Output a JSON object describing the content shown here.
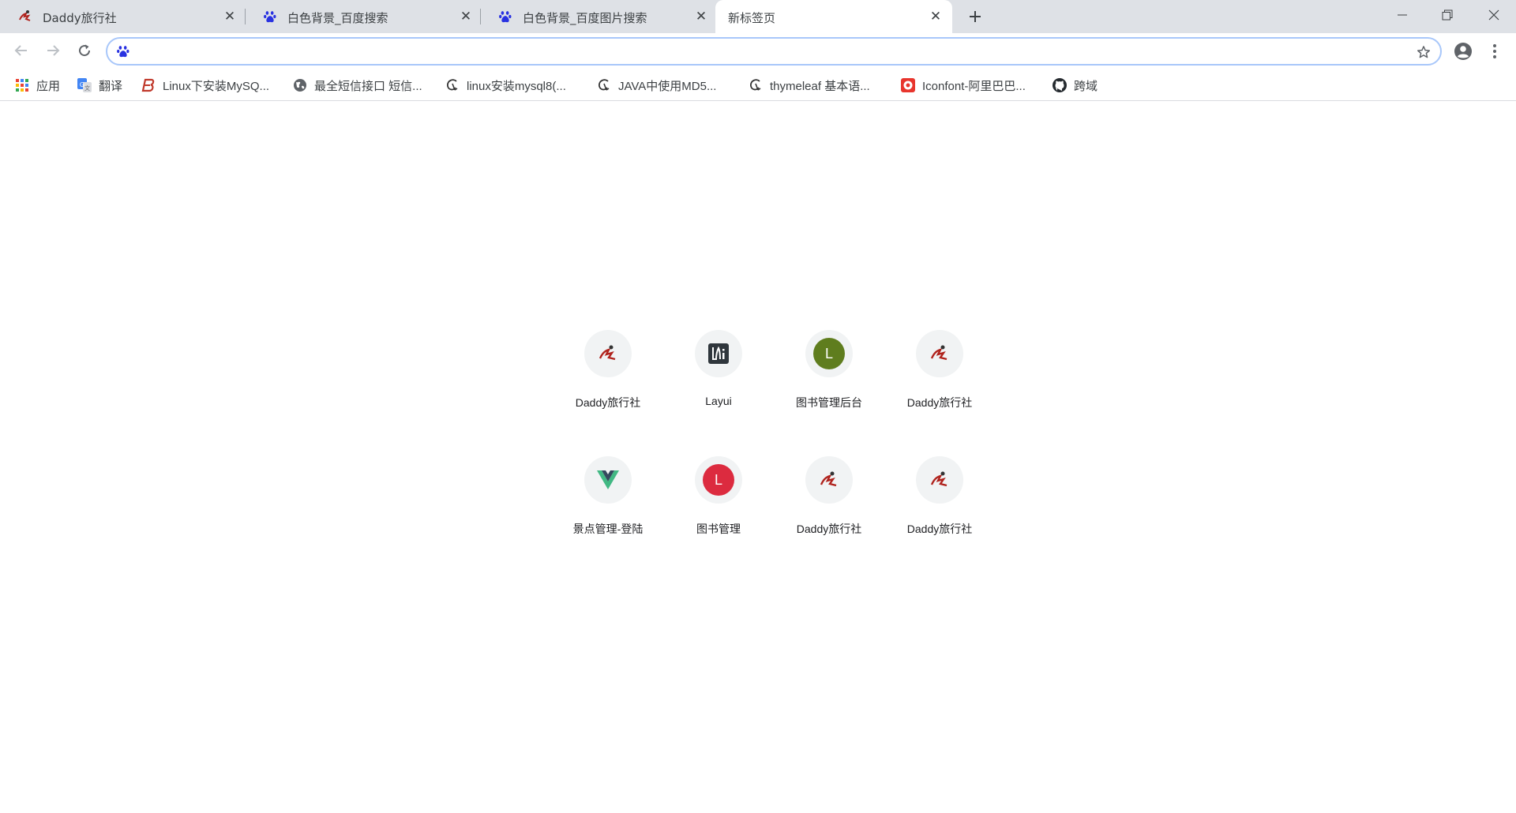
{
  "tabs": [
    {
      "title": "Daddy旅行社",
      "icon": "daddy-logo-icon"
    },
    {
      "title": "白色背景_百度搜索",
      "icon": "baidu-paw-icon"
    },
    {
      "title": "白色背景_百度图片搜索",
      "icon": "baidu-paw-icon"
    },
    {
      "title": "新标签页",
      "icon": "none",
      "active": true
    }
  ],
  "omnibox": {
    "value": "",
    "placeholder": ""
  },
  "bookmarks": [
    {
      "label": "应用",
      "icon": "apps-grid-icon"
    },
    {
      "label": "翻译",
      "icon": "google-translate-icon"
    },
    {
      "label": "Linux下安装MySQ...",
      "icon": "b-logo-icon"
    },
    {
      "label": "最全短信接口 短信...",
      "icon": "globe-icon"
    },
    {
      "label": "linux安装mysql8(...",
      "icon": "csdn-c-icon"
    },
    {
      "label": "JAVA中使用MD5...",
      "icon": "csdn-c-icon"
    },
    {
      "label": "thymeleaf 基本语...",
      "icon": "csdn-c-icon"
    },
    {
      "label": "Iconfont-阿里巴巴...",
      "icon": "iconfont-icon"
    },
    {
      "label": "跨域",
      "icon": "github-icon"
    }
  ],
  "shortcuts": [
    {
      "label": "Daddy旅行社",
      "icon": "daddy-logo-icon"
    },
    {
      "label": "Layui",
      "icon": "layui-logo-icon"
    },
    {
      "label": "图书管理后台",
      "icon": "letter-avatar",
      "letter": "L",
      "color": "#5f7d1e"
    },
    {
      "label": "Daddy旅行社",
      "icon": "daddy-logo-icon"
    },
    {
      "label": "景点管理-登陆",
      "icon": "vue-logo-icon"
    },
    {
      "label": "图书管理",
      "icon": "letter-avatar",
      "letter": "L",
      "color": "#dc2b3f"
    },
    {
      "label": "Daddy旅行社",
      "icon": "daddy-logo-icon"
    },
    {
      "label": "Daddy旅行社",
      "icon": "daddy-logo-icon"
    }
  ],
  "colors": {
    "tabstrip": "#dee1e6",
    "omnibox_focus": "#a8c7fa",
    "baidu_blue": "#2932e1"
  }
}
